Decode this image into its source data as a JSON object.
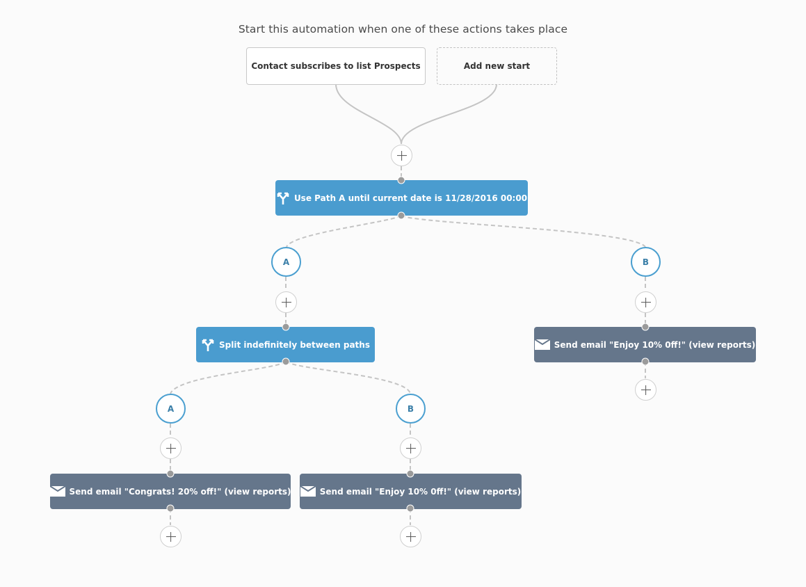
{
  "heading": "Start this automation when one of these actions takes place",
  "triggers": [
    {
      "label": "Contact subscribes to list Prospects"
    },
    {
      "label": "Add new start"
    }
  ],
  "colors": {
    "split_node": "#4a9ccf",
    "email_node": "#65768b",
    "branch_ring": "#4a9fd0",
    "connector": "#c4c4c4",
    "background": "#fbfbfb"
  },
  "nodes": {
    "date_split": {
      "type": "split",
      "icon": "split-icon",
      "label": "Use Path A until current date is 11/28/2016 00:00"
    },
    "random_split": {
      "type": "split",
      "icon": "split-icon",
      "label": "Split indefinitely between paths"
    },
    "email_a_a": {
      "type": "email",
      "icon": "envelope-icon",
      "label": "Send email \"Congrats! 20% off!\" (view reports)"
    },
    "email_a_b": {
      "type": "email",
      "icon": "envelope-icon",
      "label": "Send email \"Enjoy 10% 0ff!\" (view reports)"
    },
    "email_b": {
      "type": "email",
      "icon": "envelope-icon",
      "label": "Send email \"Enjoy 10% 0ff!\" (view reports)"
    }
  },
  "branches": {
    "top_a": "A",
    "top_b": "B",
    "inner_a": "A",
    "inner_b": "B"
  },
  "add_step_icon": "plus-icon"
}
